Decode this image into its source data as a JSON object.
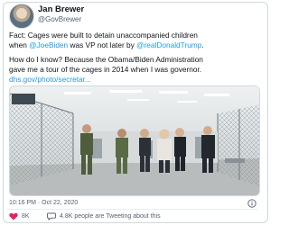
{
  "author": {
    "name": "Jan Brewer",
    "handle": "@GovBrewer"
  },
  "tweet": {
    "line1": "Fact:  Cages were built to detain unaccompanied children",
    "line2_pre": "when ",
    "line2_mention1": "@JoeBiden",
    "line2_mid": "  was VP not later by ",
    "line2_mention2": "@realDonaldTrump",
    "line2_post": ".",
    "line3": "How do I know? Because the Obama/Biden Administration",
    "line4": "gave me a tour of the cages in 2014 when I was governor.",
    "link": "dhs.gov/photo/secretar..."
  },
  "timestamp": "10:16 PM · Oct 22, 2020",
  "actions": {
    "likes": "8K",
    "tweeting": "4.8K people are Tweeting about this"
  },
  "colors": {
    "accent": "#1d9bf0",
    "like": "#e0245e",
    "secondary": "#536471"
  },
  "icons": [
    "info-icon",
    "heart-icon",
    "reply-icon"
  ]
}
